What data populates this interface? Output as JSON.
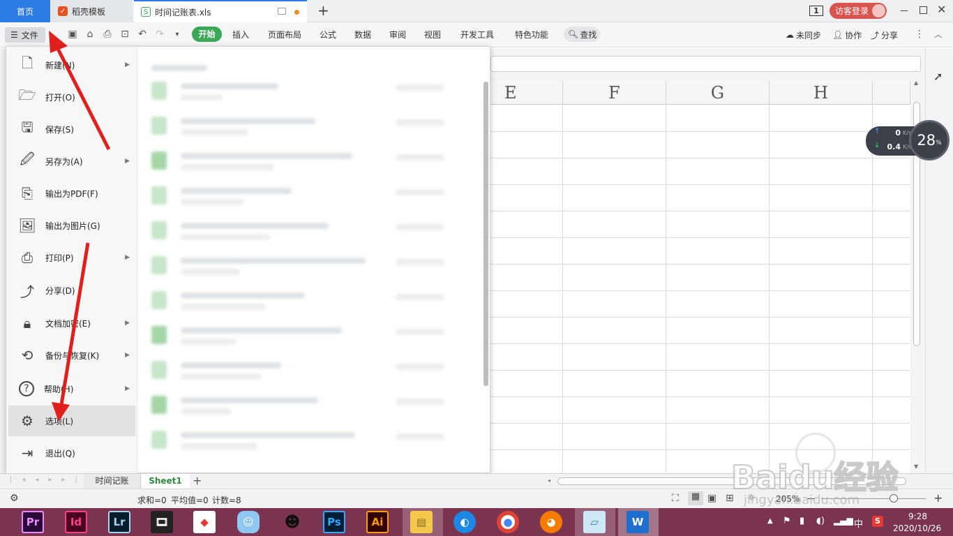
{
  "tabs": {
    "home": "首页",
    "template": "稻壳模板",
    "document": "时间记账表.xls",
    "new_tab": "+"
  },
  "titlebar": {
    "window_count": "1",
    "login": "访客登录"
  },
  "toolbar": {
    "file": "文件",
    "ribbon": [
      "开始",
      "插入",
      "页面布局",
      "公式",
      "数据",
      "审阅",
      "视图",
      "开发工具",
      "特色功能"
    ],
    "search": "查找",
    "unsync": "未同步",
    "collab": "协作",
    "share": "分享"
  },
  "menu": {
    "items": [
      {
        "label": "新建(N)",
        "icon": "new-file-icon",
        "has_sub": true
      },
      {
        "label": "打开(O)",
        "icon": "folder-open-icon",
        "has_sub": false
      },
      {
        "label": "保存(S)",
        "icon": "save-icon",
        "has_sub": false
      },
      {
        "label": "另存为(A)",
        "icon": "save-as-icon",
        "has_sub": true
      },
      {
        "label": "输出为PDF(F)",
        "icon": "pdf-export-icon",
        "has_sub": false
      },
      {
        "label": "输出为图片(G)",
        "icon": "image-export-icon",
        "has_sub": false
      },
      {
        "label": "打印(P)",
        "icon": "printer-icon",
        "has_sub": true
      },
      {
        "label": "分享(D)",
        "icon": "share-icon",
        "has_sub": false
      },
      {
        "label": "文档加密(E)",
        "icon": "encrypt-icon",
        "has_sub": true
      },
      {
        "label": "备份与恢复(K)",
        "icon": "backup-icon",
        "has_sub": true
      },
      {
        "label": "帮助(H)",
        "icon": "help-icon",
        "has_sub": true
      },
      {
        "label": "选项(L)",
        "icon": "gear-icon",
        "has_sub": false,
        "selected": true
      },
      {
        "label": "退出(Q)",
        "icon": "exit-icon",
        "has_sub": false
      }
    ]
  },
  "grid": {
    "columns": [
      "E",
      "F",
      "G",
      "H"
    ]
  },
  "network": {
    "up": "0",
    "down": "0.4",
    "unit": "K/s",
    "cpu": "28",
    "cpu_unit": "%"
  },
  "sheets": {
    "tabs": [
      "时间记账",
      "Sheet1"
    ],
    "active": "Sheet1",
    "add": "+"
  },
  "status": {
    "sum": "求和=0",
    "avg": "平均值=0",
    "count": "计数=8",
    "zoom": "205%"
  },
  "taskbar": {
    "apps": [
      "Pr",
      "Id",
      "Lr",
      "Ps",
      "Ai"
    ],
    "time": "9:28",
    "date": "2020/10/26",
    "ime": "中"
  },
  "watermark": {
    "text": "Baidu经验",
    "url": "jingyan.baidu.com"
  },
  "colors": {
    "accent_blue": "#2d7be5",
    "start_green": "#3aa856",
    "taskbar": "#7a3450",
    "arrow_red": "#e0201c"
  }
}
